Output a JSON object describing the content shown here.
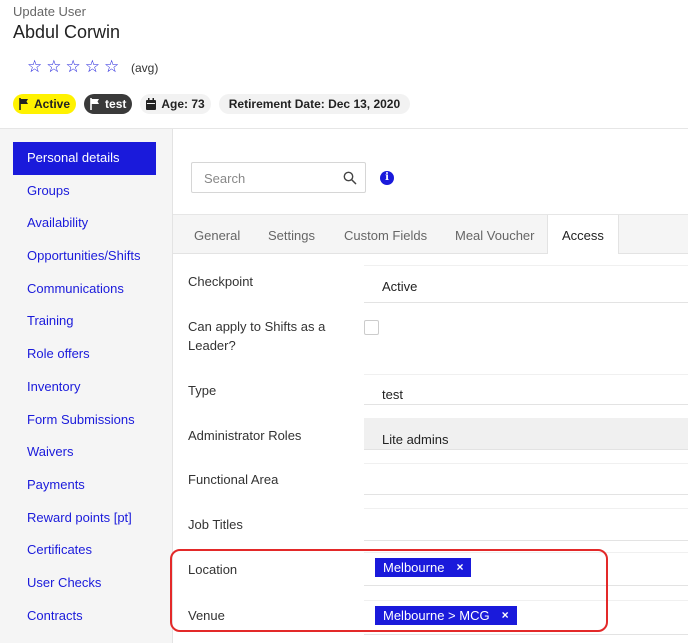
{
  "header": {
    "subtitle": "Update User",
    "user_name": "Abdul Corwin",
    "rating": {
      "stars": 5,
      "filled": 0,
      "avg_label": "(avg)"
    },
    "badges": {
      "status": "Active",
      "role": "test",
      "age": "Age: 73",
      "retirement": "Retirement Date: Dec 13, 2020"
    }
  },
  "sidebar": {
    "items": [
      {
        "label": "Personal details",
        "active": true
      },
      {
        "label": "Groups"
      },
      {
        "label": "Availability"
      },
      {
        "label": "Opportunities/Shifts"
      },
      {
        "label": "Communications"
      },
      {
        "label": "Training"
      },
      {
        "label": "Role offers"
      },
      {
        "label": "Inventory"
      },
      {
        "label": "Form Submissions"
      },
      {
        "label": "Waivers"
      },
      {
        "label": "Payments"
      },
      {
        "label": "Reward points [pt]"
      },
      {
        "label": "Certificates"
      },
      {
        "label": "User Checks"
      },
      {
        "label": "Contracts"
      }
    ]
  },
  "search": {
    "placeholder": "Search",
    "value": ""
  },
  "tabs": [
    {
      "label": "General"
    },
    {
      "label": "Settings"
    },
    {
      "label": "Custom Fields"
    },
    {
      "label": "Meal Voucher"
    },
    {
      "label": "Access",
      "active": true
    }
  ],
  "form": {
    "checkpoint": {
      "label": "Checkpoint",
      "value": "Active"
    },
    "shift_leader": {
      "label": "Can apply to Shifts as a Leader?",
      "checked": false
    },
    "type": {
      "label": "Type",
      "value": "test"
    },
    "admin_roles": {
      "label": "Administrator Roles",
      "value": "Lite admins"
    },
    "functional_area": {
      "label": "Functional Area",
      "value": ""
    },
    "job_titles": {
      "label": "Job Titles",
      "value": ""
    },
    "location": {
      "label": "Location",
      "chips": [
        "Melbourne"
      ]
    },
    "venue": {
      "label": "Venue",
      "chips": [
        "Melbourne > MCG"
      ]
    },
    "remove_symbol": "×"
  },
  "colors": {
    "accent": "#1a1adb",
    "active_badge": "#fff200",
    "highlight": "#e32929"
  }
}
